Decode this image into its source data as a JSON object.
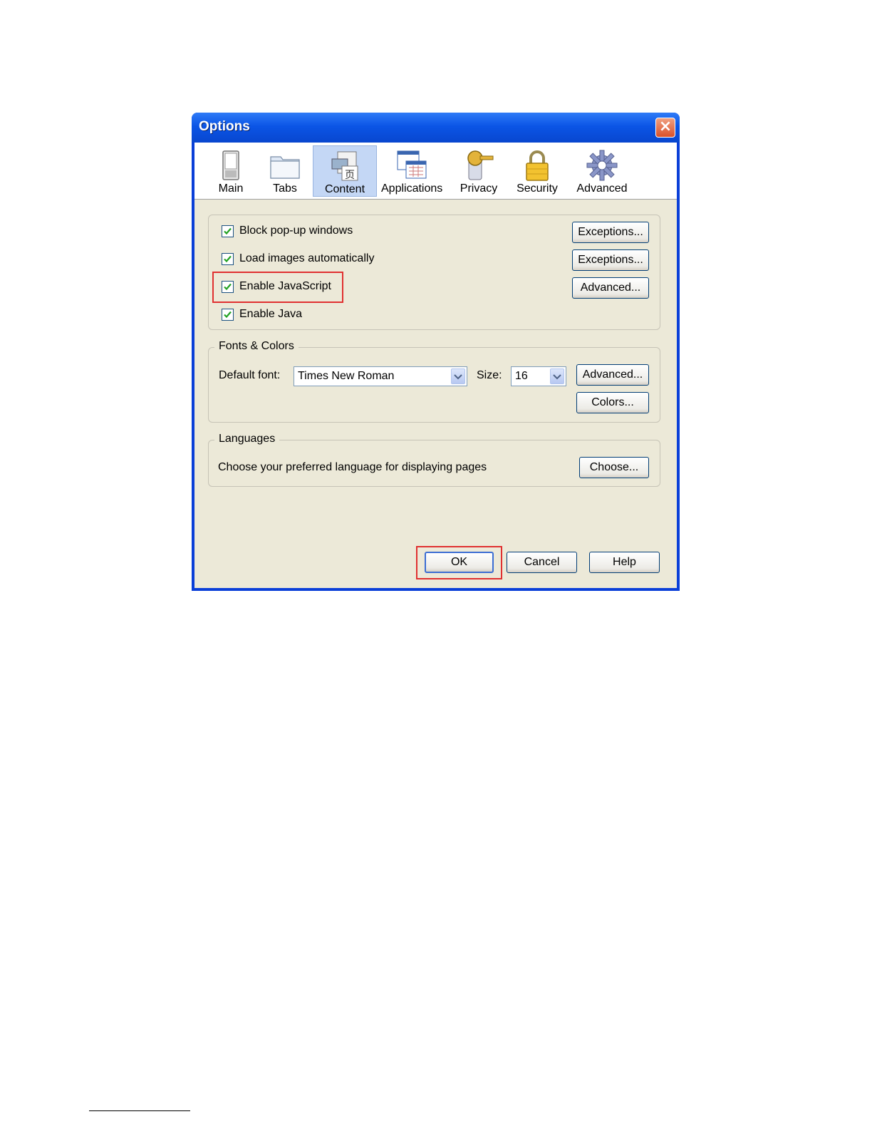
{
  "window": {
    "title": "Options",
    "close_label": "×"
  },
  "toolbar": {
    "items": [
      {
        "label": "Main",
        "icon": "switch-icon"
      },
      {
        "label": "Tabs",
        "icon": "folder-tabs-icon"
      },
      {
        "label": "Content",
        "icon": "content-page-icon",
        "selected": true
      },
      {
        "label": "Applications",
        "icon": "applications-window-icon"
      },
      {
        "label": "Privacy",
        "icon": "privacy-key-icon"
      },
      {
        "label": "Security",
        "icon": "padlock-icon"
      },
      {
        "label": "Advanced",
        "icon": "gear-icon"
      }
    ]
  },
  "content_group": {
    "block_popups": {
      "label": "Block pop-up windows",
      "checked": true,
      "button": "Exceptions..."
    },
    "load_images": {
      "label": "Load images automatically",
      "checked": true,
      "button": "Exceptions..."
    },
    "enable_js": {
      "label": "Enable JavaScript",
      "checked": true,
      "button": "Advanced..."
    },
    "enable_java": {
      "label": "Enable Java",
      "checked": true
    }
  },
  "fonts_group": {
    "legend": "Fonts & Colors",
    "default_font_label": "Default font:",
    "default_font_value": "Times New Roman",
    "size_label": "Size:",
    "size_value": "16",
    "advanced_button": "Advanced...",
    "colors_button": "Colors..."
  },
  "languages_group": {
    "legend": "Languages",
    "description": "Choose your preferred language for displaying pages",
    "choose_button": "Choose..."
  },
  "footer": {
    "ok": "OK",
    "cancel": "Cancel",
    "help": "Help"
  },
  "colors": {
    "title_bar": "#0b55e6",
    "dialog_bg": "#ece9d8",
    "highlight": "#e03030",
    "check": "#21a121"
  }
}
